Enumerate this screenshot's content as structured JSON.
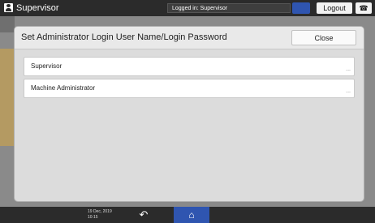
{
  "top_bar": {
    "user_name": "Supervisor",
    "logged_in_text": "Logged in: Supervisor",
    "logout_label": "Logout"
  },
  "dialog": {
    "title": "Set Administrator Login User Name/Login Password",
    "close_label": "Close",
    "items": [
      {
        "label": "Supervisor",
        "corner": "..."
      },
      {
        "label": "Machine Administrator",
        "corner": "..."
      }
    ]
  },
  "bottom_bar": {
    "datetime": "19 Dec, 2019\n10:15"
  },
  "icons": {
    "user": "user-icon",
    "help": "help-icon",
    "phone": "phone-icon",
    "back": "back-arrow-icon",
    "home": "home-icon"
  },
  "colors": {
    "top_bar": "#2b2b2b",
    "accent_blue": "#2f55b0",
    "dialog_bg": "#dcdcdc"
  }
}
